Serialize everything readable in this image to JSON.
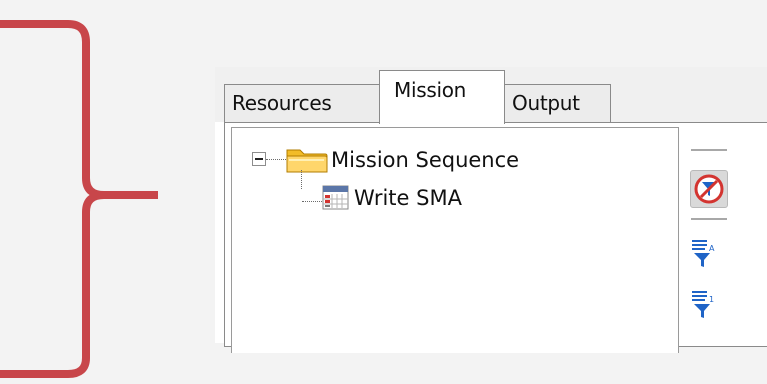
{
  "tabs": [
    {
      "label": "Resources"
    },
    {
      "label": "Mission"
    },
    {
      "label": "Output"
    }
  ],
  "tree": {
    "root_label": "Mission Sequence",
    "items": [
      {
        "label": "Write SMA"
      }
    ]
  },
  "icons": {
    "expander": "minus-box-icon",
    "root": "folder-icon",
    "item": "grid-table-icon",
    "filter_toggle": "no-filter-icon",
    "filter_alpha": "sort-filter-alpha-icon",
    "filter_numeric": "sort-filter-numeric-icon"
  },
  "colors": {
    "bracket": "#c8464a",
    "folder": "#f2bc28",
    "filter_button_red": "#d33430",
    "funnel_blue": "#1f64c7"
  }
}
